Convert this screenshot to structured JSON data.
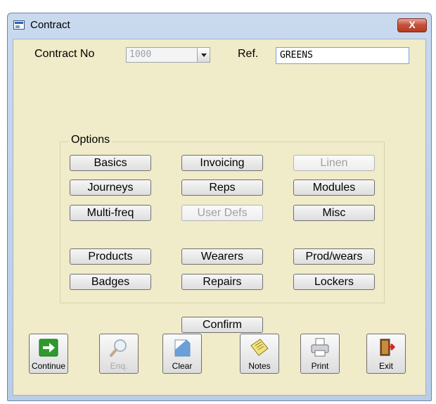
{
  "window": {
    "title": "Contract",
    "close_label": "X"
  },
  "header": {
    "contract_label": "Contract No",
    "contract_value": "1000",
    "ref_label": "Ref.",
    "ref_value": "GREENS"
  },
  "options": {
    "title": "Options",
    "basics": "Basics",
    "invoicing": "Invoicing",
    "linen": "Linen",
    "journeys": "Journeys",
    "reps": "Reps",
    "modules": "Modules",
    "multifreq": "Multi-freq",
    "userdefs": "User Defs",
    "misc": "Misc",
    "products": "Products",
    "wearers": "Wearers",
    "prodwears": "Prod/wears",
    "badges": "Badges",
    "repairs": "Repairs",
    "lockers": "Lockers"
  },
  "confirm_label": "Confirm",
  "toolbar": {
    "continue": "Continue",
    "enq": "Enq.",
    "clear": "Clear",
    "notes": "Notes",
    "print": "Print",
    "exit": "Exit",
    "icons": [
      "arrow-right-icon",
      "magnifier-icon",
      "page-icon",
      "note-pad-icon",
      "printer-icon",
      "door-exit-icon"
    ]
  },
  "colors": {
    "form_bg": "#f0ebc8",
    "frame": "#b9cde7",
    "close": "#c6533d",
    "continue_green": "#2e9a2e"
  }
}
